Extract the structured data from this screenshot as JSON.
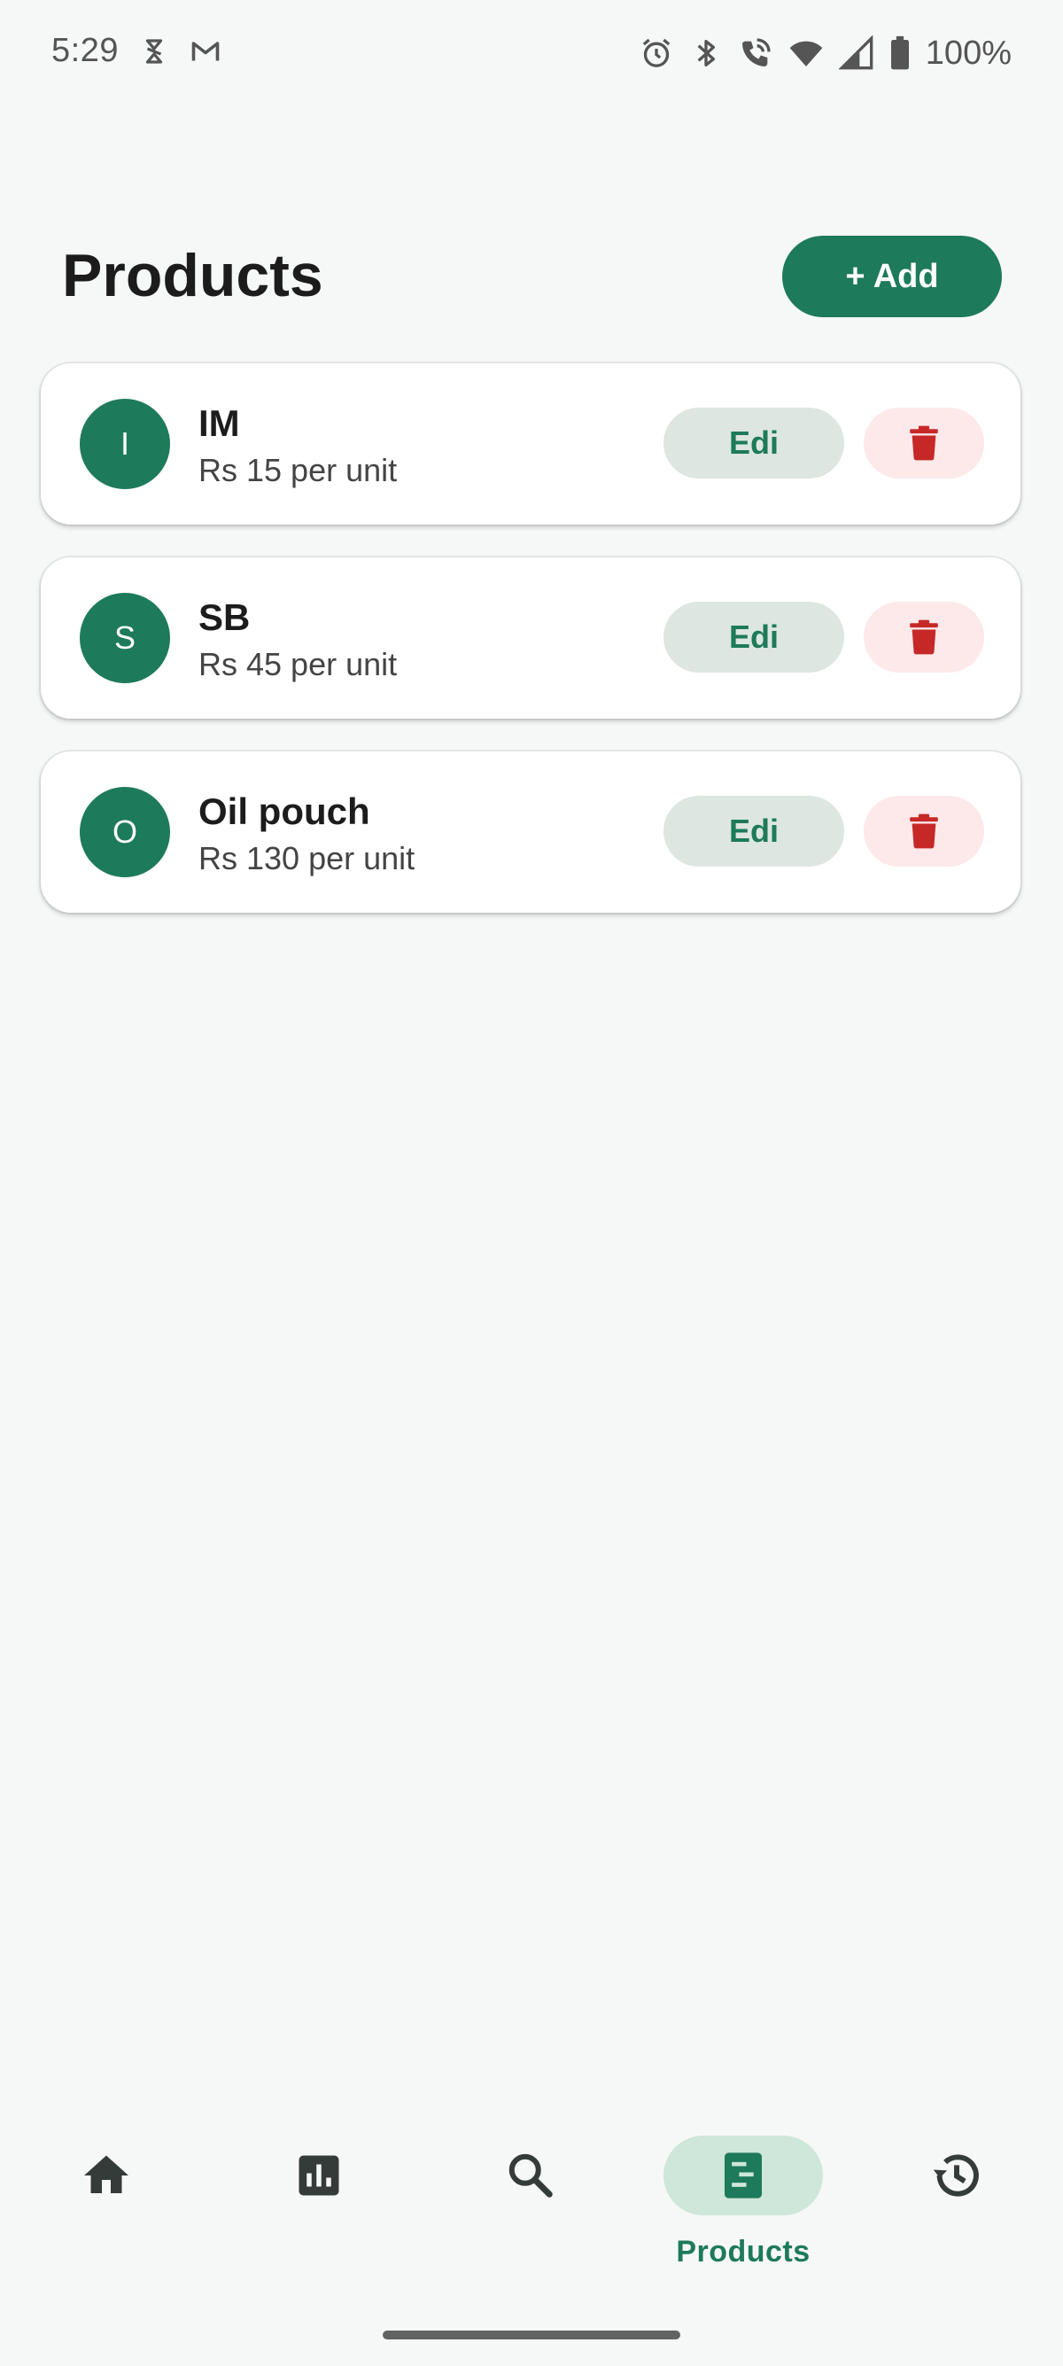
{
  "status_bar": {
    "time": "5:29",
    "battery": "100%"
  },
  "header": {
    "title": "Products",
    "add_label": "+ Add"
  },
  "products": [
    {
      "initial": "I",
      "name": "IM",
      "price": "Rs 15 per unit",
      "edit_label": "Edi"
    },
    {
      "initial": "S",
      "name": "SB",
      "price": "Rs 45 per unit",
      "edit_label": "Edi"
    },
    {
      "initial": "O",
      "name": "Oil pouch",
      "price": "Rs 130 per unit",
      "edit_label": "Edi"
    }
  ],
  "nav": {
    "items": [
      {
        "icon": "home-icon"
      },
      {
        "icon": "bar-chart-icon"
      },
      {
        "icon": "search-icon"
      },
      {
        "icon": "products-icon",
        "label": "Products",
        "active": true
      },
      {
        "icon": "history-icon"
      }
    ]
  },
  "colors": {
    "accent": "#1d7a5a",
    "delete": "#c62828",
    "delete_bg": "#fde8ea",
    "edit_bg": "#dde6e0",
    "background": "#f6f8f7"
  }
}
